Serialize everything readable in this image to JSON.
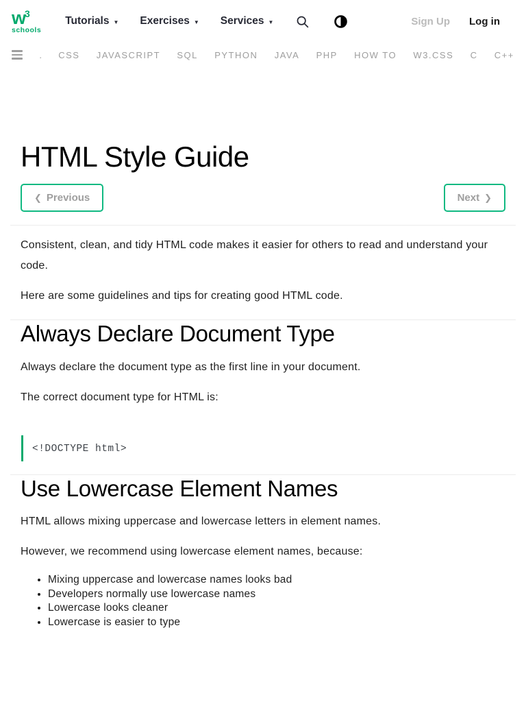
{
  "brand": {
    "w": "w",
    "sup": "3",
    "schools": "schools"
  },
  "topnav": {
    "menu": [
      {
        "label": "Tutorials"
      },
      {
        "label": "Exercises"
      },
      {
        "label": "Services"
      }
    ],
    "caret": "▼",
    "signup_label": "Sign Up",
    "login_label": "Log in"
  },
  "subnav": {
    "items": [
      ".",
      "CSS",
      "JAVASCRIPT",
      "SQL",
      "PYTHON",
      "JAVA",
      "PHP",
      "HOW TO",
      "W3.CSS",
      "C",
      "C++"
    ]
  },
  "page": {
    "title": "HTML Style Guide",
    "prev": {
      "chevron": "❮",
      "label": "Previous"
    },
    "next": {
      "label": "Next",
      "chevron": "❯"
    }
  },
  "intro": {
    "paragraphs": [
      "Consistent, clean, and tidy HTML code makes it easier for others to read and understand your code.",
      "Here are some guidelines and tips for creating good HTML code."
    ]
  },
  "section_doctype": {
    "heading": "Always Declare Document Type",
    "paragraphs": [
      "Always declare the document type as the first line in your document.",
      "The correct document type for HTML is:"
    ],
    "code": "<!DOCTYPE html>"
  },
  "section_lowercase": {
    "heading": "Use Lowercase Element Names",
    "paragraphs": [
      "HTML allows mixing uppercase and lowercase letters in element names.",
      "However, we recommend using lowercase element names, because:"
    ],
    "bullets": [
      "Mixing uppercase and lowercase names looks bad",
      "Developers normally use lowercase names",
      "Lowercase looks cleaner",
      "Lowercase is easier to type"
    ]
  },
  "colors": {
    "brand_green": "#04AA6D",
    "button_border_green": "#10b981",
    "subnav_gray": "#9e9e9e",
    "signup_gray": "#bbbbbb"
  }
}
